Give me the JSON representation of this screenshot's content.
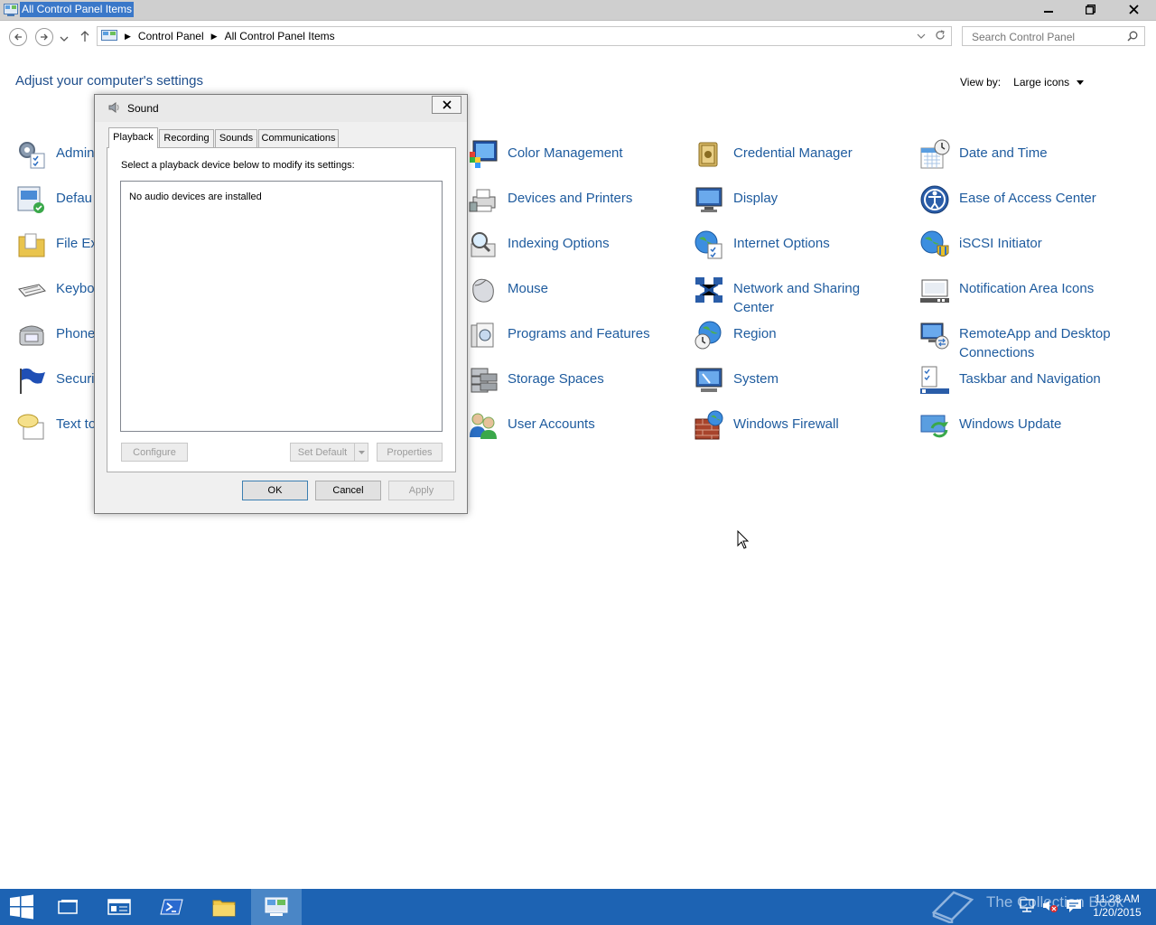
{
  "window": {
    "title": "All Control Panel Items",
    "controls": [
      "minimize",
      "restore",
      "close"
    ]
  },
  "nav": {
    "breadcrumb": [
      "Control Panel",
      "All Control Panel Items"
    ],
    "search_placeholder": "Search Control Panel"
  },
  "main": {
    "heading": "Adjust your computer's settings",
    "view_by_label": "View by:",
    "view_by_value": "Large icons"
  },
  "items": {
    "col1": [
      {
        "label": "Admin",
        "icon": "admin-tools-icon"
      },
      {
        "label": "Defau",
        "icon": "default-programs-icon"
      },
      {
        "label": "File Ex",
        "icon": "file-explorer-icon"
      },
      {
        "label": "Keybo",
        "icon": "keyboard-icon"
      },
      {
        "label": "Phone",
        "icon": "phone-icon"
      },
      {
        "label": "Securi",
        "icon": "security-flag-icon"
      },
      {
        "label": "Text to",
        "icon": "speech-bubble-icon"
      }
    ],
    "col2": [
      {
        "label": "Color Management",
        "icon": "color-management-icon"
      },
      {
        "label": "Devices and Printers",
        "icon": "printer-icon"
      },
      {
        "label": "Indexing Options",
        "icon": "indexing-icon"
      },
      {
        "label": "Mouse",
        "icon": "mouse-icon"
      },
      {
        "label": "Programs and Features",
        "icon": "programs-icon"
      },
      {
        "label": "Storage Spaces",
        "icon": "storage-icon"
      },
      {
        "label": "User Accounts",
        "icon": "users-icon"
      }
    ],
    "col3": [
      {
        "label": "Credential Manager",
        "icon": "credential-icon"
      },
      {
        "label": "Display",
        "icon": "display-icon"
      },
      {
        "label": "Internet Options",
        "icon": "internet-icon"
      },
      {
        "label": "Network and Sharing",
        "label2": "Center",
        "icon": "network-icon"
      },
      {
        "label": "Region",
        "icon": "region-icon"
      },
      {
        "label": "System",
        "icon": "system-icon"
      },
      {
        "label": "Windows Firewall",
        "icon": "firewall-icon"
      }
    ],
    "col4": [
      {
        "label": "Date and Time",
        "icon": "calendar-clock-icon"
      },
      {
        "label": "Ease of Access Center",
        "icon": "ease-of-access-icon"
      },
      {
        "label": "iSCSI Initiator",
        "icon": "iscsi-icon"
      },
      {
        "label": "Notification Area Icons",
        "icon": "notification-area-icon"
      },
      {
        "label": "RemoteApp and Desktop",
        "label2": "Connections",
        "icon": "remoteapp-icon"
      },
      {
        "label": "Taskbar and Navigation",
        "icon": "taskbar-icon"
      },
      {
        "label": "Windows Update",
        "icon": "windows-update-icon"
      }
    ]
  },
  "dialog": {
    "title": "Sound",
    "tabs": [
      "Playback",
      "Recording",
      "Sounds",
      "Communications"
    ],
    "active_tab": "Playback",
    "instruction": "Select a playback device below to modify its settings:",
    "empty_message": "No audio devices are installed",
    "buttons": {
      "configure": "Configure",
      "set_default": "Set Default",
      "properties": "Properties",
      "ok": "OK",
      "cancel": "Cancel",
      "apply": "Apply"
    }
  },
  "taskbar": {
    "watermark": "The Collection Book",
    "time": "11:28 AM",
    "date": "1/20/2015",
    "accent": "#1d63b3"
  }
}
